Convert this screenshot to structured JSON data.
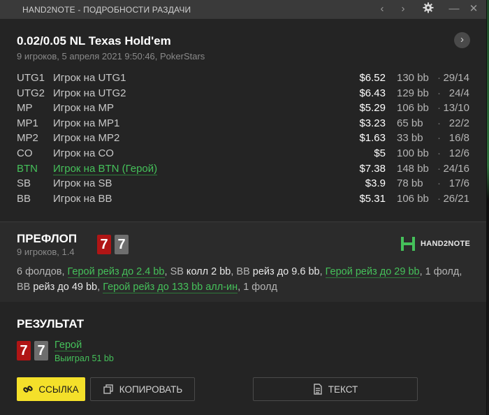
{
  "window": {
    "title": "HAND2NOTE - ПОДРОБНОСТИ РАЗДАЧИ"
  },
  "hand": {
    "title": "0.02/0.05 NL Texas Hold'em",
    "subtitle": "9 игроков, 5 апреля 2021 9:50:46, PokerStars"
  },
  "players": [
    {
      "pos": "UTG1",
      "name": "Игрок на UTG1",
      "stack": "$6.52",
      "bb": "130 bb",
      "stats": "29/14",
      "hero": false
    },
    {
      "pos": "UTG2",
      "name": "Игрок на UTG2",
      "stack": "$6.43",
      "bb": "129 bb",
      "stats": "24/4",
      "hero": false
    },
    {
      "pos": "MP",
      "name": "Игрок на MP",
      "stack": "$5.29",
      "bb": "106 bb",
      "stats": "13/10",
      "hero": false
    },
    {
      "pos": "MP1",
      "name": "Игрок на MP1",
      "stack": "$3.23",
      "bb": "65 bb",
      "stats": "22/2",
      "hero": false
    },
    {
      "pos": "MP2",
      "name": "Игрок на MP2",
      "stack": "$1.63",
      "bb": "33 bb",
      "stats": "16/8",
      "hero": false
    },
    {
      "pos": "CO",
      "name": "Игрок на CO",
      "stack": "$5",
      "bb": "100 bb",
      "stats": "12/6",
      "hero": false
    },
    {
      "pos": "BTN",
      "name": "Игрок на BTN (Герой)",
      "stack": "$7.38",
      "bb": "148 bb",
      "stats": "24/16",
      "hero": true
    },
    {
      "pos": "SB",
      "name": "Игрок на SB",
      "stack": "$3.9",
      "bb": "78 bb",
      "stats": "17/6",
      "hero": false
    },
    {
      "pos": "BB",
      "name": "Игрок на BB",
      "stack": "$5.31",
      "bb": "106 bb",
      "stats": "26/21",
      "hero": false
    }
  ],
  "preflop": {
    "title": "ПРЕФЛОП",
    "subtitle": "9 игроков, 1.4",
    "cards": [
      "7",
      "7"
    ],
    "logo_text": "HAND2NOTE",
    "actions": [
      {
        "text": "6 фолдов, ",
        "style": "grey"
      },
      {
        "text": "Герой рейз до 2.4 bb",
        "style": "hero"
      },
      {
        "text": ", ",
        "style": "grey"
      },
      {
        "text": "SB",
        "style": "grey"
      },
      {
        "text": " колл 2 bb",
        "style": "white"
      },
      {
        "text": ", ",
        "style": "grey"
      },
      {
        "text": "BB",
        "style": "grey"
      },
      {
        "text": " рейз до 9.6 bb",
        "style": "white"
      },
      {
        "text": ", ",
        "style": "grey"
      },
      {
        "text": "Герой рейз до 29 bb",
        "style": "hero"
      },
      {
        "text": ", 1 фолд, ",
        "style": "grey"
      },
      {
        "text": "BB",
        "style": "grey"
      },
      {
        "text": " рейз до 49 bb",
        "style": "white"
      },
      {
        "text": ", ",
        "style": "grey"
      },
      {
        "text": "Герой рейз до 133 bb алл-ин",
        "style": "hero"
      },
      {
        "text": ", 1 фолд",
        "style": "grey"
      }
    ]
  },
  "result": {
    "title": "РЕЗУЛЬТАТ",
    "cards": [
      "7",
      "7"
    ],
    "name": "Герой",
    "won": "Выиграл 51 bb"
  },
  "buttons": {
    "link": "ССЫЛКА",
    "copy": "КОПИРОВАТЬ",
    "text": "ТЕКСТ"
  },
  "colors": {
    "hero": "#45c15a",
    "card_red": "#b01515",
    "card_grey": "#6e6e6e",
    "link_button": "#f4e02a"
  }
}
